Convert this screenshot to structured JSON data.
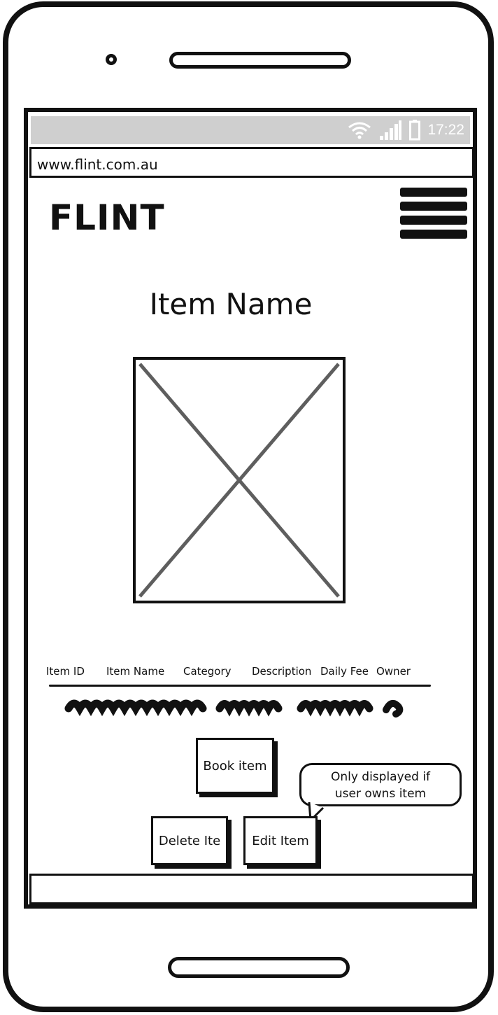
{
  "status_bar": {
    "time": "17:22",
    "icons": [
      "wifi-icon",
      "signal-icon",
      "battery-icon"
    ]
  },
  "browser": {
    "url": "www.flint.com.au"
  },
  "header": {
    "logo": "FLINT",
    "menu_icon": "hamburger-menu-icon"
  },
  "item": {
    "title": "Item Name",
    "image_icon": "image-placeholder-icon"
  },
  "table": {
    "columns": [
      "Item ID",
      "Item Name",
      "Category",
      "Description",
      "Daily Fee",
      "Owner"
    ]
  },
  "actions": {
    "book_label": "Book item",
    "delete_label": "Delete Ite",
    "edit_label": "Edit Item"
  },
  "callout": {
    "line1": "Only displayed if",
    "line2": "user owns item"
  },
  "colors": {
    "statusbar_bg": "#cfcfcf",
    "ink": "#111111",
    "placeholder_x": "#5e5e5e"
  }
}
